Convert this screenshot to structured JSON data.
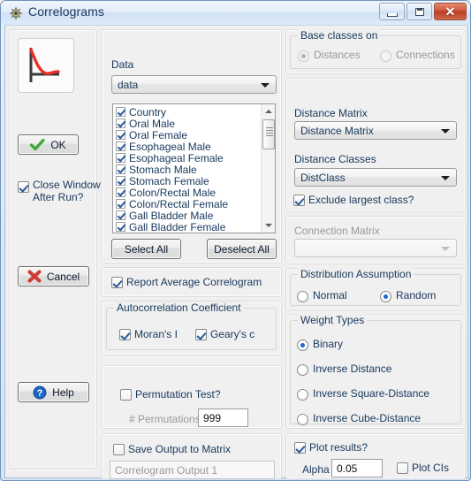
{
  "window": {
    "title": "Correlograms",
    "icon": "sun-app-icon",
    "controls": {
      "minimize": "minimize-button",
      "maximize": "maximize-button",
      "close_label": "✕"
    }
  },
  "left_panel": {
    "preview_icon": "correlogram-curve-icon",
    "ok_button": "OK",
    "close_window_checkbox": {
      "label_line1": "Close Window",
      "label_line2": "After Run?",
      "checked": true
    },
    "cancel_button": "Cancel",
    "help_button": "Help"
  },
  "data_panel": {
    "group_title": "Data",
    "dataset_combo": {
      "value": "data",
      "options": [
        "data"
      ]
    },
    "variables": [
      {
        "label": "Country",
        "checked": true
      },
      {
        "label": "Oral Male",
        "checked": true
      },
      {
        "label": "Oral Female",
        "checked": true
      },
      {
        "label": "Esophageal Male",
        "checked": true
      },
      {
        "label": "Esophageal Female",
        "checked": true
      },
      {
        "label": "Stomach Male",
        "checked": true
      },
      {
        "label": "Stomach Female",
        "checked": true
      },
      {
        "label": "Colon/Rectal Male",
        "checked": true
      },
      {
        "label": "Colon/Rectal Female",
        "checked": true
      },
      {
        "label": "Gall Bladder Male",
        "checked": true
      },
      {
        "label": "Gall Bladder Female",
        "checked": true
      }
    ],
    "select_all_button": "Select All",
    "deselect_all_button": "Deselect All",
    "report_average_checkbox": {
      "label": "Report Average Correlogram",
      "checked": true
    }
  },
  "autocorrelation": {
    "group_title": "Autocorrelation Coefficient",
    "morans_i": {
      "label": "Moran's I",
      "checked": true
    },
    "gearys_c": {
      "label": "Geary's c",
      "checked": true
    }
  },
  "permutation": {
    "test_checkbox": {
      "label": "Permutation Test?",
      "checked": false
    },
    "permutations_label": "# Permutations",
    "permutations_value": "999",
    "enabled": false
  },
  "save_output": {
    "checkbox": {
      "label": "Save Output to Matrix",
      "checked": false
    },
    "matrix_name": "Correlogram Output 1",
    "enabled": false
  },
  "base_classes": {
    "group_title": "Base classes on",
    "enabled": false,
    "options": [
      {
        "label": "Distances",
        "selected": true
      },
      {
        "label": "Connections",
        "selected": false
      }
    ]
  },
  "distance": {
    "matrix_label": "Distance Matrix",
    "matrix_combo": {
      "value": "Distance Matrix",
      "options": [
        "Distance Matrix"
      ]
    },
    "classes_label": "Distance Classes",
    "classes_combo": {
      "value": "DistClass",
      "options": [
        "DistClass"
      ]
    },
    "exclude_largest": {
      "label": "Exclude largest class?",
      "checked": true
    }
  },
  "connection": {
    "label": "Connection Matrix",
    "combo": {
      "value": "",
      "options": []
    },
    "enabled": false
  },
  "distribution": {
    "group_title": "Distribution Assumption",
    "options": [
      {
        "label": "Normal",
        "selected": false
      },
      {
        "label": "Random",
        "selected": true
      }
    ]
  },
  "weight_types": {
    "group_title": "Weight Types",
    "options": [
      {
        "label": "Binary",
        "selected": true
      },
      {
        "label": "Inverse Distance",
        "selected": false
      },
      {
        "label": "Inverse Square-Distance",
        "selected": false
      },
      {
        "label": "Inverse Cube-Distance",
        "selected": false
      }
    ]
  },
  "plot": {
    "plot_results": {
      "label": "Plot results?",
      "checked": true
    },
    "alpha_label": "Alpha",
    "alpha_value": "0.05",
    "plot_cis": {
      "label": "Plot CIs",
      "checked": false
    }
  }
}
